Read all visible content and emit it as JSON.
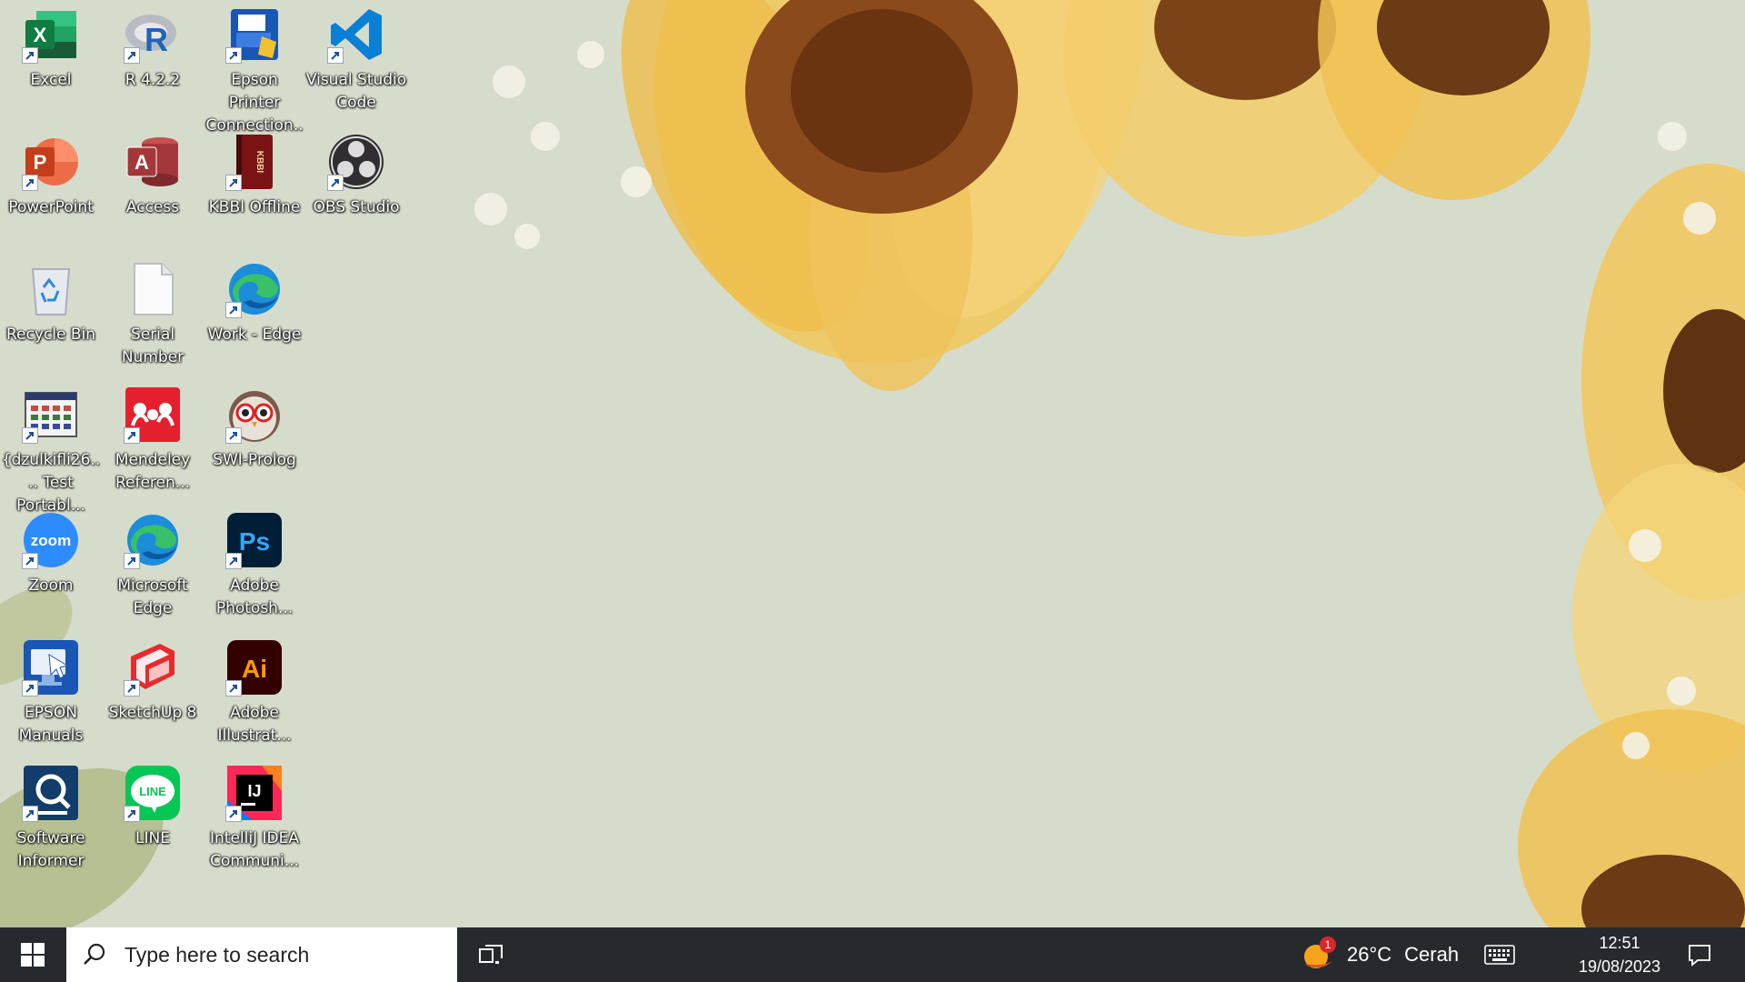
{
  "desktop": {
    "icons": [
      {
        "label": "Excel"
      },
      {
        "label": "R 4.2.2"
      },
      {
        "label": "Epson Printer Connection..."
      },
      {
        "label": "Visual Studio Code"
      },
      {
        "label": "PowerPoint"
      },
      {
        "label": "Access"
      },
      {
        "label": "KBBI Offline"
      },
      {
        "label": "OBS Studio"
      },
      {
        "label": "Recycle Bin"
      },
      {
        "label": "Serial Number"
      },
      {
        "label": "Work - Edge"
      },
      {
        "label": "{dzulkifli26.... Test Portabl..."
      },
      {
        "label": "Mendeley Referen..."
      },
      {
        "label": "SWI-Prolog"
      },
      {
        "label": "Zoom"
      },
      {
        "label": "Microsoft Edge"
      },
      {
        "label": "Adobe Photosh..."
      },
      {
        "label": "EPSON Manuals"
      },
      {
        "label": "SketchUp 8"
      },
      {
        "label": "Adobe Illustrat..."
      },
      {
        "label": "Software Informer"
      },
      {
        "label": "LINE"
      },
      {
        "label": "IntelliJ IDEA Communi..."
      }
    ],
    "icon_text": {
      "zoom": "zoom",
      "ps": "Ps",
      "ai": "Ai",
      "ij": "IJ",
      "line": "LINE",
      "kbbi": "KBBI",
      "word_x": "X",
      "word_p": "P",
      "word_a": "A",
      "word_r": "R"
    }
  },
  "taskbar": {
    "search_placeholder": "Type here to search",
    "weather": {
      "temp": "26°C",
      "condition": "Cerah",
      "badge": "1"
    },
    "clock": {
      "time": "12:51",
      "date": "19/08/2023"
    }
  },
  "colors": {
    "taskbar": "#262a2e",
    "wallpaper": "#d6dccb",
    "excel": "#1d6f42",
    "powerpoint": "#c43e1c",
    "access": "#a4373a",
    "vscode": "#0078d4",
    "zoom": "#2d8cff",
    "photoshop": "#001e36",
    "illustrator": "#330000",
    "line": "#06c755"
  }
}
